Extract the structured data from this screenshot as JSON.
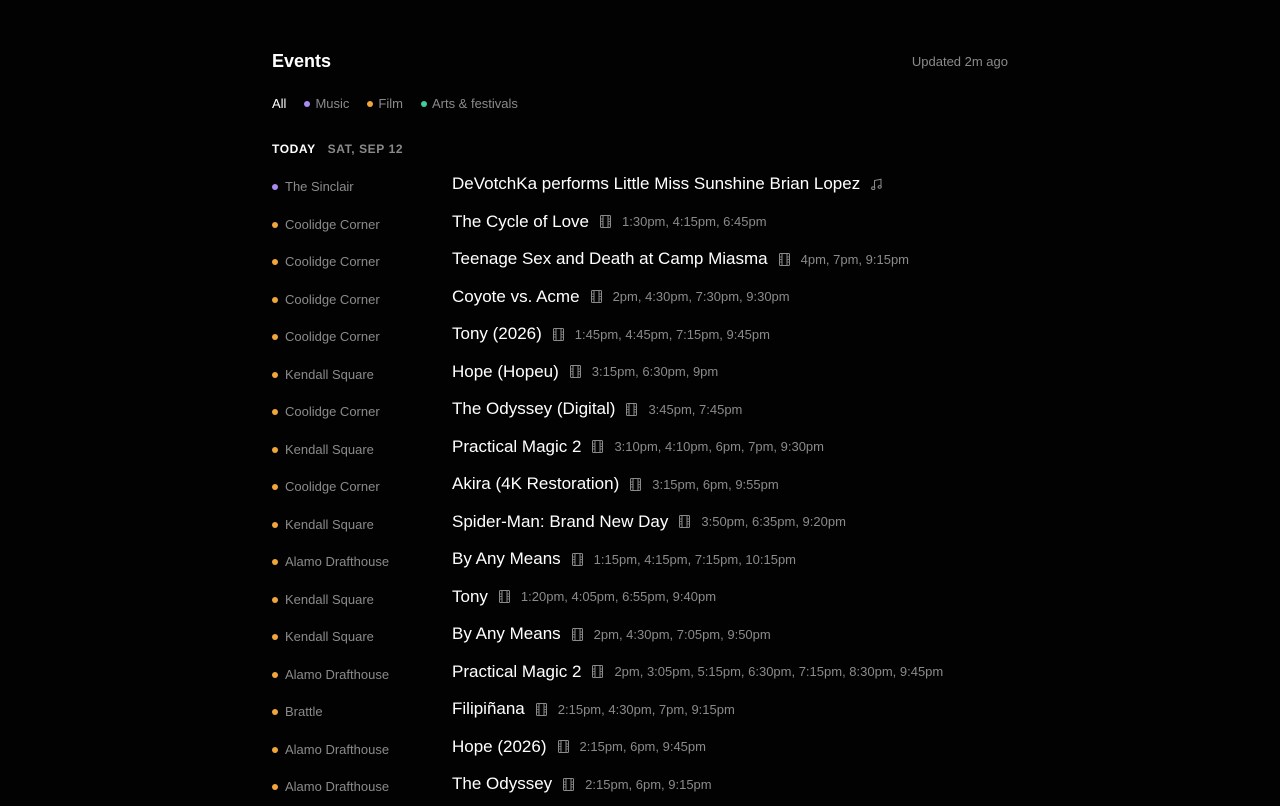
{
  "header": {
    "title": "Events",
    "updated": "Updated 2m ago"
  },
  "filters": [
    {
      "label": "All",
      "active": true,
      "color": ""
    },
    {
      "label": "Music",
      "active": false,
      "color": "#a98bf0"
    },
    {
      "label": "Film",
      "active": false,
      "color": "#f0a63a"
    },
    {
      "label": "Arts & festivals",
      "active": false,
      "color": "#3fcf9e"
    }
  ],
  "colors": {
    "music": "#a98bf0",
    "film": "#f0a63a",
    "arts": "#3fcf9e"
  },
  "day": {
    "today_label": "TODAY",
    "date_label": "SAT, SEP 12"
  },
  "events": [
    {
      "venue": "The Sinclair",
      "category": "music",
      "title": "DeVotchKa performs Little Miss Sunshine Brian Lopez",
      "icon": "music-note-icon",
      "times": ""
    },
    {
      "venue": "Coolidge Corner",
      "category": "film",
      "title": "The Cycle of Love",
      "icon": "film-icon",
      "times": "1:30pm, 4:15pm, 6:45pm"
    },
    {
      "venue": "Coolidge Corner",
      "category": "film",
      "title": "Teenage Sex and Death at Camp Miasma",
      "icon": "film-icon",
      "times": "4pm, 7pm, 9:15pm"
    },
    {
      "venue": "Coolidge Corner",
      "category": "film",
      "title": "Coyote vs. Acme",
      "icon": "film-icon",
      "times": "2pm, 4:30pm, 7:30pm, 9:30pm"
    },
    {
      "venue": "Coolidge Corner",
      "category": "film",
      "title": "Tony (2026)",
      "icon": "film-icon",
      "times": "1:45pm, 4:45pm, 7:15pm, 9:45pm"
    },
    {
      "venue": "Kendall Square",
      "category": "film",
      "title": "Hope (Hopeu)",
      "icon": "film-icon",
      "times": "3:15pm, 6:30pm, 9pm"
    },
    {
      "venue": "Coolidge Corner",
      "category": "film",
      "title": "The Odyssey (Digital)",
      "icon": "film-icon",
      "times": "3:45pm, 7:45pm"
    },
    {
      "venue": "Kendall Square",
      "category": "film",
      "title": "Practical Magic 2",
      "icon": "film-icon",
      "times": "3:10pm, 4:10pm, 6pm, 7pm, 9:30pm"
    },
    {
      "venue": "Coolidge Corner",
      "category": "film",
      "title": "Akira (4K Restoration)",
      "icon": "film-icon",
      "times": "3:15pm, 6pm, 9:55pm"
    },
    {
      "venue": "Kendall Square",
      "category": "film",
      "title": "Spider-Man: Brand New Day",
      "icon": "film-icon",
      "times": "3:50pm, 6:35pm, 9:20pm"
    },
    {
      "venue": "Alamo Drafthouse",
      "category": "film",
      "title": "By Any Means",
      "icon": "film-icon",
      "times": "1:15pm, 4:15pm, 7:15pm, 10:15pm"
    },
    {
      "venue": "Kendall Square",
      "category": "film",
      "title": "Tony",
      "icon": "film-icon",
      "times": "1:20pm, 4:05pm, 6:55pm, 9:40pm"
    },
    {
      "venue": "Kendall Square",
      "category": "film",
      "title": "By Any Means",
      "icon": "film-icon",
      "times": "2pm, 4:30pm, 7:05pm, 9:50pm"
    },
    {
      "venue": "Alamo Drafthouse",
      "category": "film",
      "title": "Practical Magic 2",
      "icon": "film-icon",
      "times": "2pm, 3:05pm, 5:15pm, 6:30pm, 7:15pm, 8:30pm, 9:45pm"
    },
    {
      "venue": "Brattle",
      "category": "film",
      "title": "Filipiñana",
      "icon": "film-icon",
      "times": "2:15pm, 4:30pm, 7pm, 9:15pm"
    },
    {
      "venue": "Alamo Drafthouse",
      "category": "film",
      "title": "Hope (2026)",
      "icon": "film-icon",
      "times": "2:15pm, 6pm, 9:45pm"
    },
    {
      "venue": "Alamo Drafthouse",
      "category": "film",
      "title": "The Odyssey",
      "icon": "film-icon",
      "times": "2:15pm, 6pm, 9:15pm"
    }
  ]
}
